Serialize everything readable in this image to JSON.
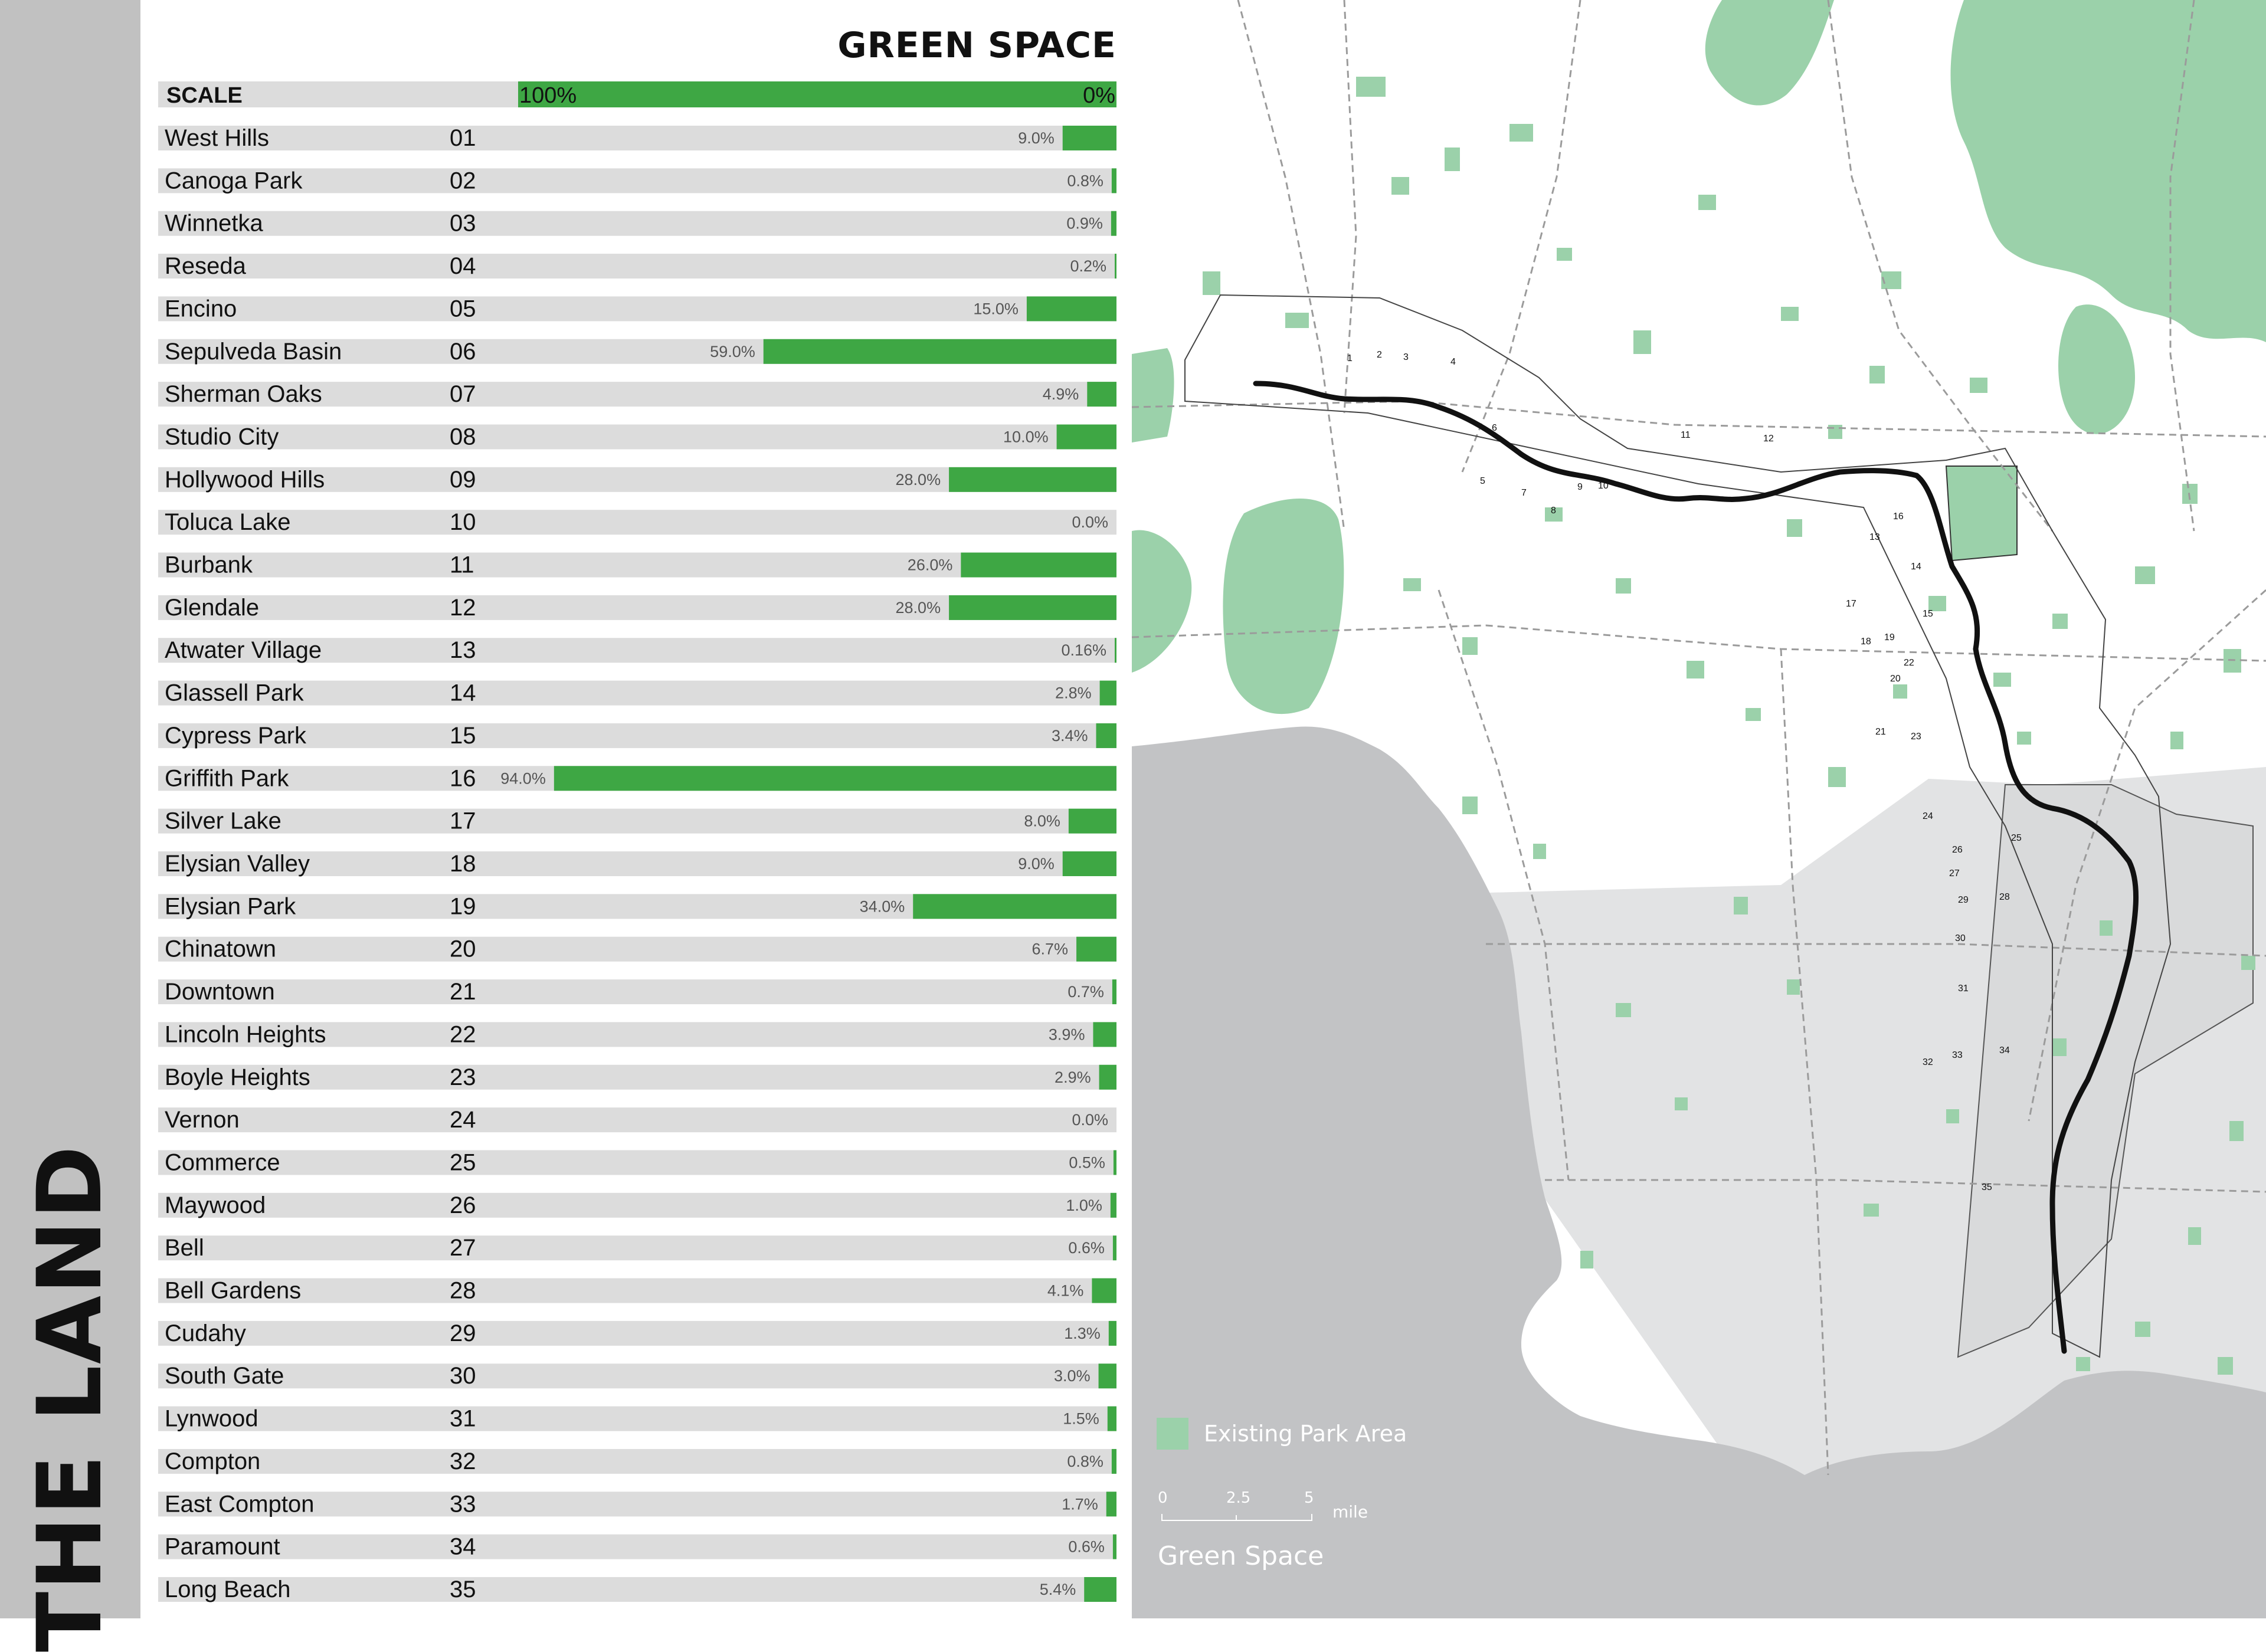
{
  "page": {
    "vertical_title": "THE LAND",
    "accent_color": "#3ea744",
    "bar_bg_color": "#dcdcdc",
    "park_color": "#9bd1aa",
    "urban_color": "#e2e3e4",
    "ocean_color": "#c2c3c5"
  },
  "chart_data": {
    "type": "bar",
    "orientation": "horizontal",
    "title": "GREEN SPACE",
    "scale": {
      "label": "SCALE",
      "left_label": "100%",
      "right_label": "0%",
      "max": 100
    },
    "rows": [
      {
        "name": "West Hills",
        "num": "01",
        "value": 9.0,
        "label": "9.0%"
      },
      {
        "name": "Canoga Park",
        "num": "02",
        "value": 0.8,
        "label": "0.8%"
      },
      {
        "name": "Winnetka",
        "num": "03",
        "value": 0.9,
        "label": "0.9%"
      },
      {
        "name": "Reseda",
        "num": "04",
        "value": 0.2,
        "label": "0.2%"
      },
      {
        "name": "Encino",
        "num": "05",
        "value": 15.0,
        "label": "15.0%"
      },
      {
        "name": "Sepulveda Basin",
        "num": "06",
        "value": 59.0,
        "label": "59.0%"
      },
      {
        "name": "Sherman Oaks",
        "num": "07",
        "value": 4.9,
        "label": "4.9%"
      },
      {
        "name": "Studio City",
        "num": "08",
        "value": 10.0,
        "label": "10.0%"
      },
      {
        "name": "Hollywood Hills",
        "num": "09",
        "value": 28.0,
        "label": "28.0%"
      },
      {
        "name": "Toluca Lake",
        "num": "10",
        "value": 0.0,
        "label": "0.0%"
      },
      {
        "name": "Burbank",
        "num": "11",
        "value": 26.0,
        "label": "26.0%"
      },
      {
        "name": "Glendale",
        "num": "12",
        "value": 28.0,
        "label": "28.0%"
      },
      {
        "name": "Atwater Village",
        "num": "13",
        "value": 0.16,
        "label": "0.16%"
      },
      {
        "name": "Glassell Park",
        "num": "14",
        "value": 2.8,
        "label": "2.8%"
      },
      {
        "name": "Cypress Park",
        "num": "15",
        "value": 3.4,
        "label": "3.4%"
      },
      {
        "name": "Griffith Park",
        "num": "16",
        "value": 94.0,
        "label": "94.0%"
      },
      {
        "name": "Silver Lake",
        "num": "17",
        "value": 8.0,
        "label": "8.0%"
      },
      {
        "name": "Elysian Valley",
        "num": "18",
        "value": 9.0,
        "label": "9.0%"
      },
      {
        "name": "Elysian Park",
        "num": "19",
        "value": 34.0,
        "label": "34.0%"
      },
      {
        "name": "Chinatown",
        "num": "20",
        "value": 6.7,
        "label": "6.7%"
      },
      {
        "name": "Downtown",
        "num": "21",
        "value": 0.7,
        "label": "0.7%"
      },
      {
        "name": "Lincoln Heights",
        "num": "22",
        "value": 3.9,
        "label": "3.9%"
      },
      {
        "name": "Boyle Heights",
        "num": "23",
        "value": 2.9,
        "label": "2.9%"
      },
      {
        "name": "Vernon",
        "num": "24",
        "value": 0.0,
        "label": "0.0%"
      },
      {
        "name": "Commerce",
        "num": "25",
        "value": 0.5,
        "label": "0.5%"
      },
      {
        "name": "Maywood",
        "num": "26",
        "value": 1.0,
        "label": "1.0%"
      },
      {
        "name": "Bell",
        "num": "27",
        "value": 0.6,
        "label": "0.6%"
      },
      {
        "name": "Bell Gardens",
        "num": "28",
        "value": 4.1,
        "label": "4.1%"
      },
      {
        "name": "Cudahy",
        "num": "29",
        "value": 1.3,
        "label": "1.3%"
      },
      {
        "name": "South Gate",
        "num": "30",
        "value": 3.0,
        "label": "3.0%"
      },
      {
        "name": "Lynwood",
        "num": "31",
        "value": 1.5,
        "label": "1.5%"
      },
      {
        "name": "Compton",
        "num": "32",
        "value": 0.8,
        "label": "0.8%"
      },
      {
        "name": "East Compton",
        "num": "33",
        "value": 1.7,
        "label": "1.7%"
      },
      {
        "name": "Paramount",
        "num": "34",
        "value": 0.6,
        "label": "0.6%"
      },
      {
        "name": "Long Beach",
        "num": "35",
        "value": 5.4,
        "label": "5.4%"
      }
    ]
  },
  "map": {
    "legend": {
      "label": "Existing Park Area"
    },
    "scalebar": {
      "ticks": [
        "0",
        "2.5",
        "5"
      ],
      "unit": "mile"
    },
    "caption": "Green Space",
    "district_labels": [
      "1",
      "2",
      "3",
      "4",
      "5",
      "6",
      "7",
      "8",
      "9",
      "10",
      "11",
      "12",
      "13",
      "14",
      "15",
      "16",
      "17",
      "18",
      "19",
      "20",
      "21",
      "22",
      "23",
      "24",
      "25",
      "26",
      "27",
      "28",
      "29",
      "30",
      "31",
      "32",
      "33",
      "34",
      "35"
    ]
  }
}
